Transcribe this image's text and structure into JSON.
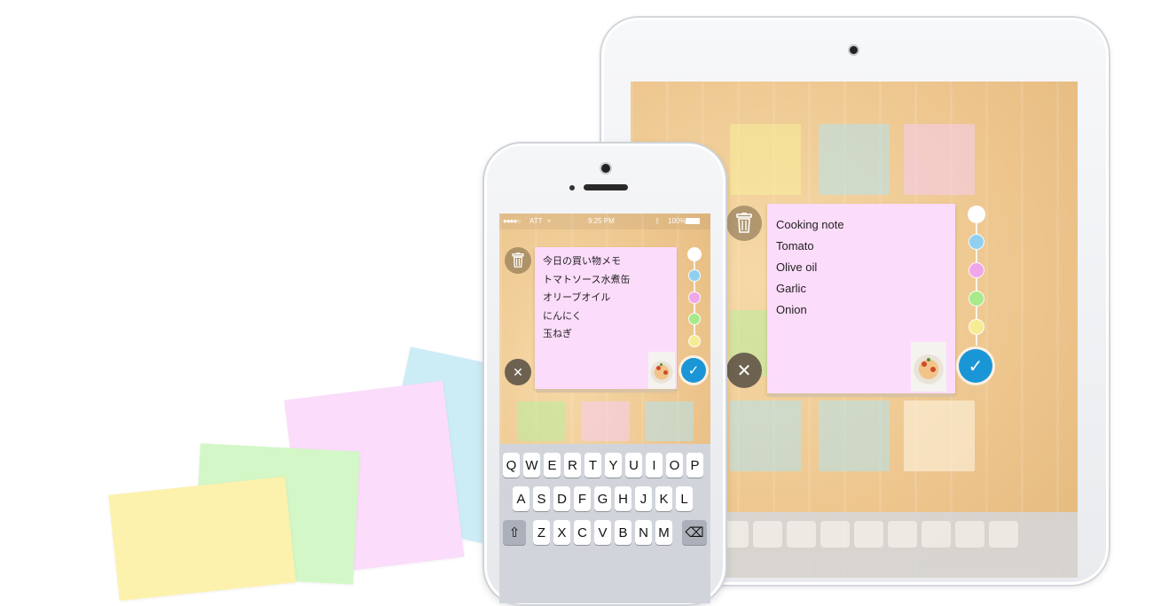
{
  "colors": {
    "note_pink": "#fcdcfb",
    "paper_blue": "#ccecf6",
    "paper_pink": "#fbdcfb",
    "paper_green": "#d3f7c6",
    "paper_yellow": "#fdf1ae",
    "swatch_white": "#ffffff",
    "swatch_blue": "#8fd0f1",
    "swatch_pink": "#efa6ea",
    "swatch_green": "#a8ea8b",
    "swatch_yellow": "#f6ec94",
    "confirm_blue": "#1a96d6"
  },
  "ipad": {
    "note_lines": [
      "Cooking note",
      "Tomato",
      "Olive oil",
      "Garlic",
      "Onion"
    ]
  },
  "iphone": {
    "status": {
      "carrier": "ATT",
      "time": "9:25 PM",
      "battery": "100%"
    },
    "note_lines": [
      "今日の買い物メモ",
      "トマトソース水煮缶",
      "オリーブオイル",
      "にんにく",
      "玉ねぎ"
    ],
    "keyboard": {
      "row1": [
        "Q",
        "W",
        "E",
        "R",
        "T",
        "Y",
        "U",
        "I",
        "O",
        "P"
      ],
      "row2": [
        "A",
        "S",
        "D",
        "F",
        "G",
        "H",
        "J",
        "K",
        "L"
      ],
      "row3": [
        "Z",
        "X",
        "C",
        "V",
        "B",
        "N",
        "M"
      ]
    }
  },
  "icons": {
    "delete": "trash-icon",
    "cancel": "close-icon",
    "confirm": "checkmark-icon",
    "photo": "pizza-photo"
  }
}
